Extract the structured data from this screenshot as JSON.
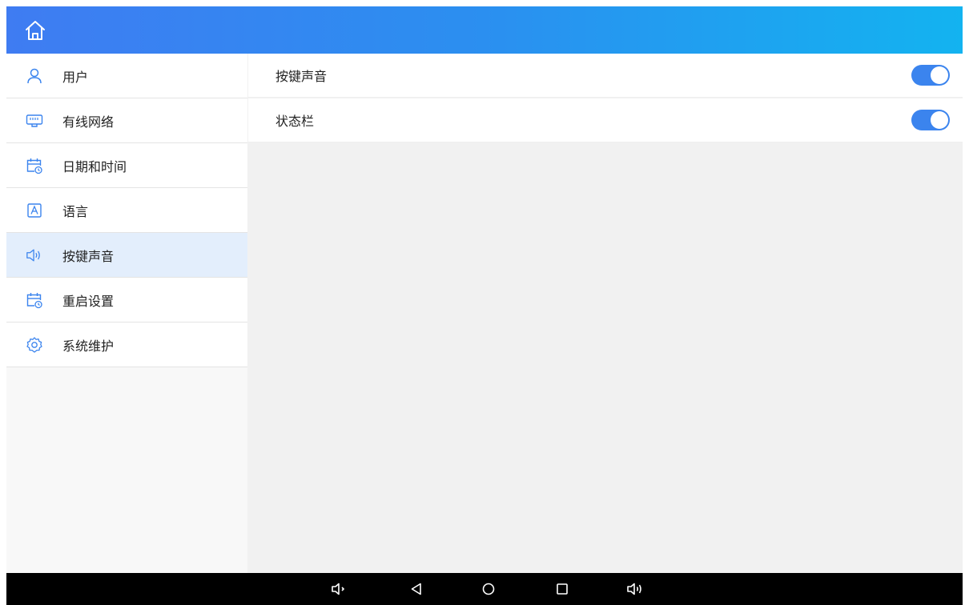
{
  "colors": {
    "header_gradient_start": "#3f7cf2",
    "header_gradient_end": "#13b3f0",
    "accent": "#3b84ee",
    "active_item_bg": "#e3eefc",
    "navbar": "#000000"
  },
  "header": {
    "home_icon": "home-icon"
  },
  "sidebar": {
    "items": [
      {
        "label": "用户",
        "icon": "user-icon"
      },
      {
        "label": "有线网络",
        "icon": "ethernet-icon"
      },
      {
        "label": "日期和时间",
        "icon": "calendar-clock-icon"
      },
      {
        "label": "语言",
        "icon": "language-icon"
      },
      {
        "label": "按键声音",
        "icon": "speaker-icon",
        "active": true
      },
      {
        "label": "重启设置",
        "icon": "calendar-clock-icon"
      },
      {
        "label": "系统维护",
        "icon": "gear-icon"
      }
    ]
  },
  "main": {
    "settings": [
      {
        "label": "按键声音",
        "enabled": true
      },
      {
        "label": "状态栏",
        "enabled": true
      }
    ]
  },
  "navbar": {
    "buttons": [
      "volume-down-icon",
      "back-icon",
      "home-circle-icon",
      "recents-icon",
      "volume-up-icon"
    ]
  }
}
